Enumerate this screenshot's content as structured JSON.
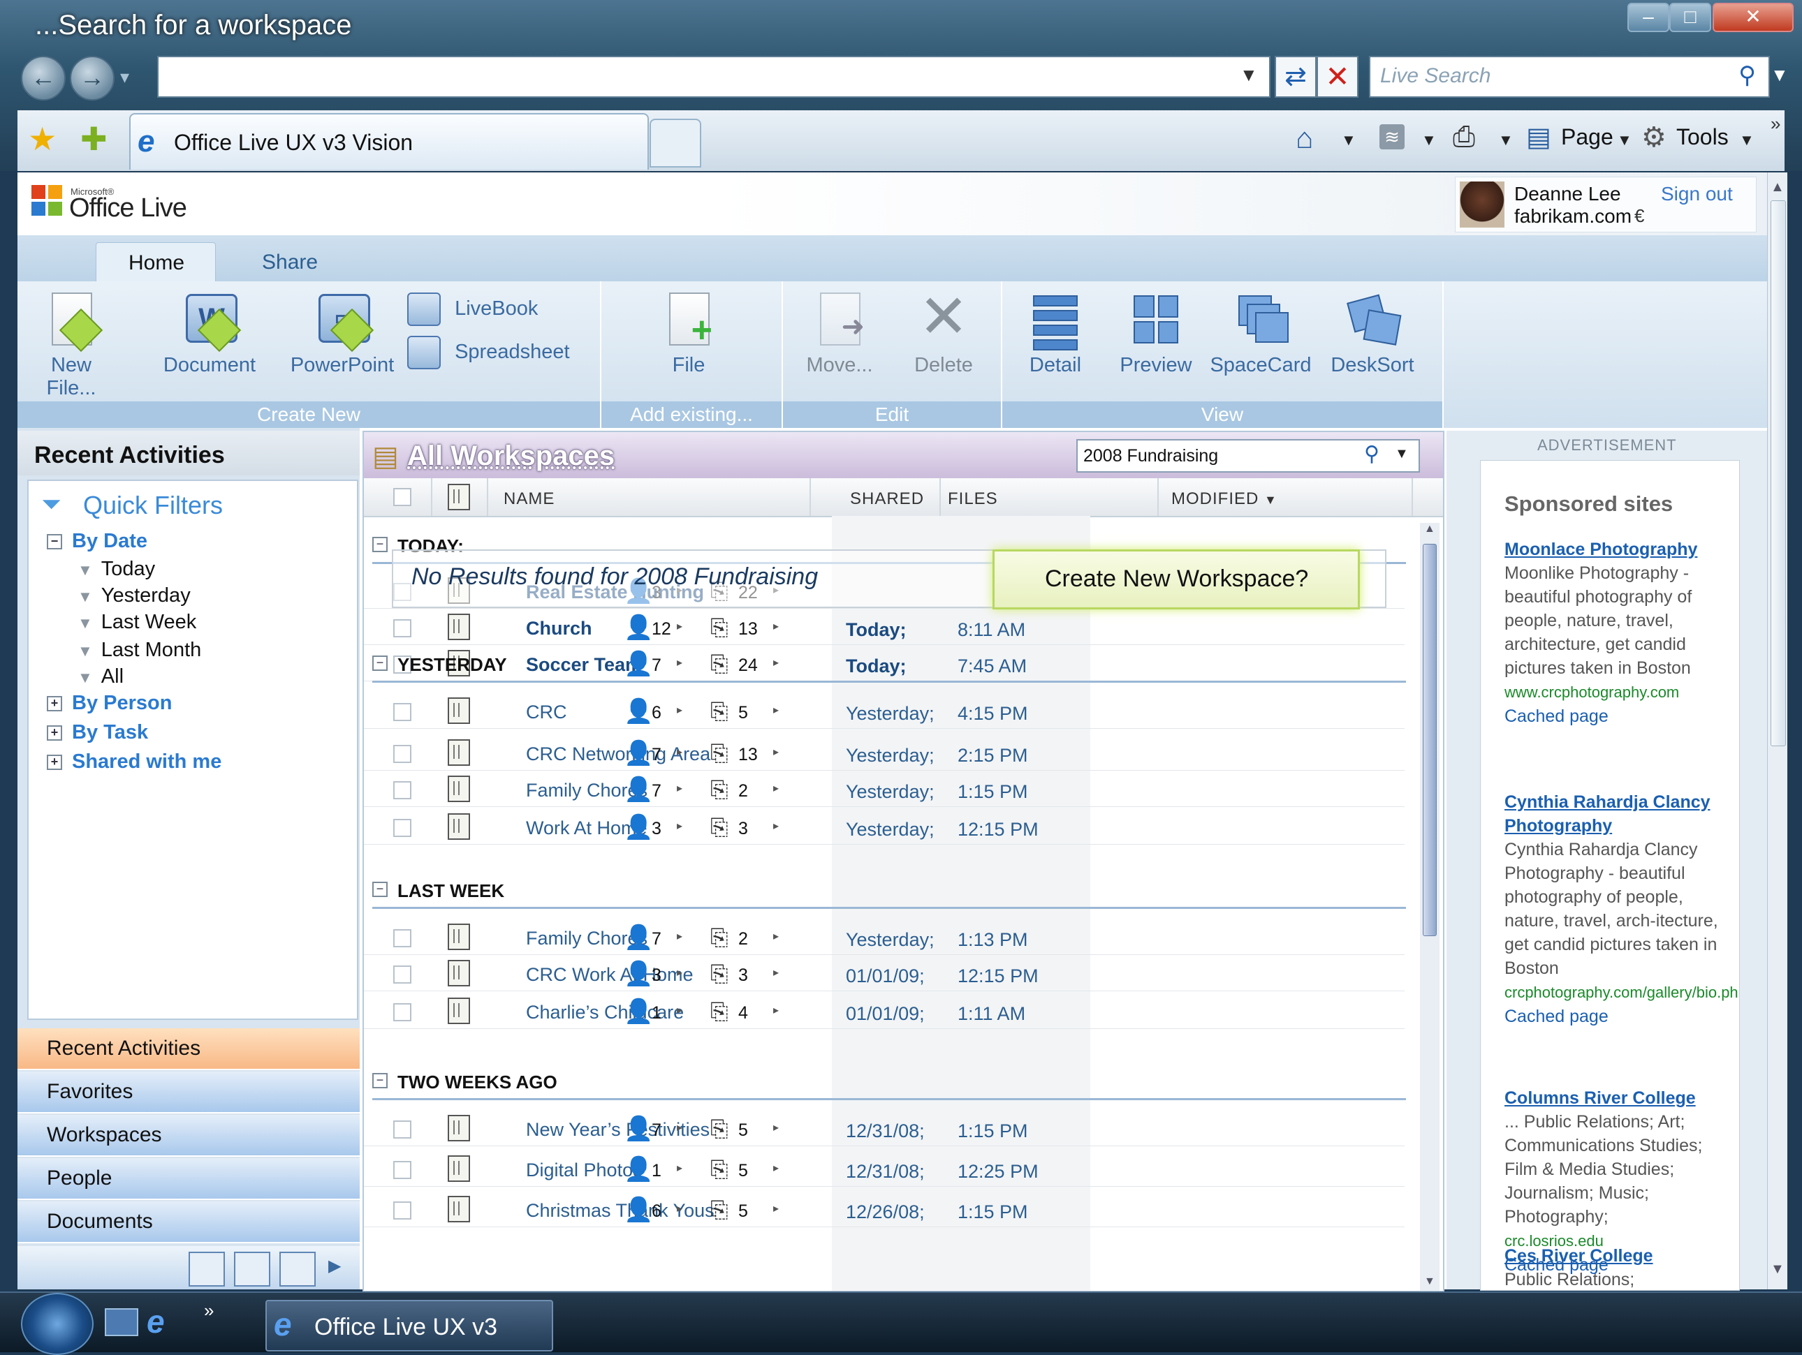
{
  "window": {
    "title": "...Search for a workspace"
  },
  "browser": {
    "live_search_placeholder": "Live Search",
    "tab_title": "Office Live UX v3 Vision",
    "page_label": "Page",
    "tools_label": "Tools"
  },
  "header": {
    "logo_small": "Microsoft®",
    "logo_text": "Office Live",
    "user_name": "Deanne Lee",
    "user_domain": "fabrikam.com",
    "currency_symbol": "€",
    "sign_out": "Sign out"
  },
  "ribbon": {
    "tabs": [
      "Home",
      "Share"
    ],
    "groups": {
      "create_new": {
        "label": "Create New",
        "new_file": "New File...",
        "document": "Document",
        "powerpoint": "PowerPoint",
        "livebook": "LiveBook",
        "spreadsheet": "Spreadsheet"
      },
      "add_existing": {
        "label": "Add existing...",
        "file": "File"
      },
      "edit": {
        "label": "Edit",
        "move": "Move...",
        "delete": "Delete"
      },
      "view": {
        "label": "View",
        "detail": "Detail",
        "preview": "Preview",
        "spacecard": "SpaceCard",
        "desksort": "DeskSort"
      }
    }
  },
  "left": {
    "title": "Recent Activities",
    "quick_filters": "Quick Filters",
    "by_date": "By Date",
    "date_items": [
      "Today",
      "Yesterday",
      "Last Week",
      "Last Month",
      "All"
    ],
    "by_person": "By Person",
    "by_task": "By Task",
    "shared_with_me": "Shared with me",
    "nav": [
      "Recent Activities",
      "Favorites",
      "Workspaces",
      "People",
      "Documents"
    ]
  },
  "main": {
    "title": "All Workspaces",
    "search_value": "2008 Fundraising",
    "columns": {
      "name": "NAME",
      "shared": "SHARED",
      "files": "FILES",
      "modified": "MODIFIED"
    },
    "no_results": "No Results found for 2008 Fundraising",
    "create_prompt": "Create New Workspace?",
    "groups": [
      {
        "label": "TODAY:",
        "rows": [
          {
            "name": "Real Estate Hunting",
            "shared": "3",
            "files": "22",
            "date": "",
            "time": "",
            "bold": true
          },
          {
            "name": "Church",
            "shared": "12",
            "files": "13",
            "date": "Today;",
            "time": "8:11 AM",
            "bold": true
          },
          {
            "name": "Soccer Team",
            "shared": "7",
            "files": "24",
            "date": "Today;",
            "time": "7:45 AM",
            "bold": true
          }
        ]
      },
      {
        "label": "YESTERDAY",
        "rows": [
          {
            "name": "CRC",
            "shared": "6",
            "files": "5",
            "date": "Yesterday;",
            "time": "4:15 PM"
          },
          {
            "name": "CRC Networking Area",
            "shared": "7",
            "files": "13",
            "date": "Yesterday;",
            "time": "2:15 PM"
          },
          {
            "name": "Family Chores",
            "shared": "7",
            "files": "2",
            "date": "Yesterday;",
            "time": "1:15 PM"
          },
          {
            "name": "Work At Home",
            "shared": "3",
            "files": "3",
            "date": "Yesterday;",
            "time": "12:15 PM"
          }
        ]
      },
      {
        "label": "LAST WEEK",
        "rows": [
          {
            "name": "Family Chores",
            "shared": "7",
            "files": "2",
            "date": "Yesterday;",
            "time": "1:13 PM"
          },
          {
            "name": "CRC Work At Home",
            "shared": "3",
            "files": "3",
            "date": "01/01/09;",
            "time": "12:15 PM"
          },
          {
            "name": "Charlie’s Childcare",
            "shared": "1",
            "files": "4",
            "date": "01/01/09;",
            "time": "1:11 AM"
          }
        ]
      },
      {
        "label": "TWO WEEKS AGO",
        "rows": [
          {
            "name": "New Year’s Festivities",
            "shared": "7",
            "files": "5",
            "date": "12/31/08;",
            "time": "1:15 PM"
          },
          {
            "name": "Digital Photos",
            "shared": "1",
            "files": "5",
            "date": "12/31/08;",
            "time": "12:25 PM"
          },
          {
            "name": "Christmas Thank Yous",
            "shared": "6",
            "files": "5",
            "date": "12/26/08;",
            "time": "1:15 PM"
          }
        ]
      }
    ]
  },
  "ads": {
    "label": "ADVERTISEMENT",
    "title": "Sponsored sites",
    "items": [
      {
        "title": "Moonlace Photography",
        "desc": "Moonlike Photography - beautiful photography of people, nature, travel, architecture, get candid pictures taken in Boston",
        "url": "www.crcphotography.com",
        "cache": "Cached page"
      },
      {
        "title": "Cynthia Rahardja Clancy Photography",
        "desc": "Cynthia Rahardja Clancy Photography - beautiful photography of people, nature, travel, arch-itecture, get candid pictures taken in Boston",
        "url": "crcphotography.com/gallery/bio.php",
        "cache": "Cached page"
      },
      {
        "title": "Columns River College",
        "desc": "... Public Relations; Art; Communications Studies; Film & Media Studies; Journalism; Music; Photography;",
        "url": "crc.losrios.edu",
        "cache": "Cached page"
      },
      {
        "title": "Ces River College",
        "desc": "Public Relations;",
        "url": "",
        "cache": ""
      }
    ]
  },
  "taskbar": {
    "task_label": "Office Live UX v3"
  },
  "icons": [
    "back-icon",
    "forward-icon",
    "refresh-icon",
    "stop-icon",
    "search-icon",
    "favorites-star-icon",
    "add-favorites-icon",
    "ie-icon",
    "home-icon",
    "feeds-icon",
    "print-icon",
    "page-icon",
    "gear-icon",
    "filter-icon",
    "person-icon",
    "file-icon",
    "windows-start-icon"
  ]
}
